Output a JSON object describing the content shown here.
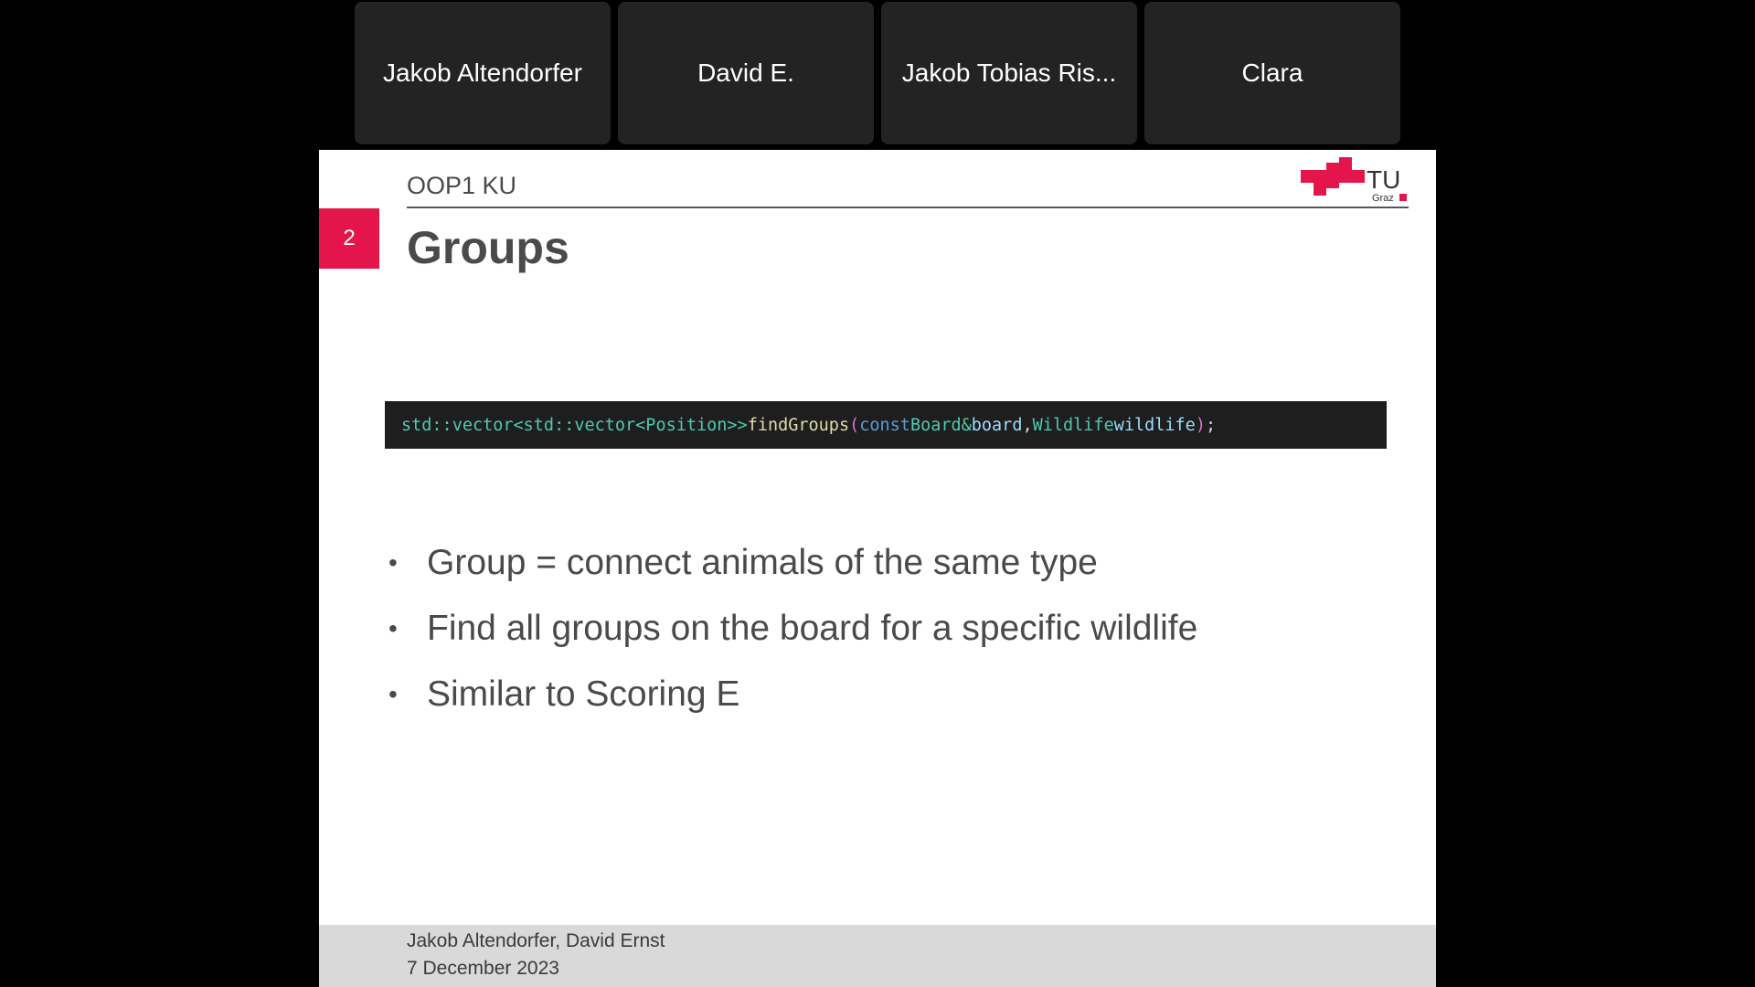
{
  "participants": [
    {
      "name": "Jakob Altendorfer"
    },
    {
      "name": "David E."
    },
    {
      "name": "Jakob Tobias Ris..."
    },
    {
      "name": "Clara"
    }
  ],
  "slide": {
    "course": "OOP1 KU",
    "logo_text": "TU",
    "logo_subtext": "Graz",
    "number": "2",
    "title": "Groups",
    "code": {
      "return_type": "std::vector<std::vector<Position>>",
      "function": "findGroups",
      "open_paren": "(",
      "kw_const": "const",
      "param1_type": "Board&",
      "param1_name": "board",
      "comma": ",",
      "param2_type": "Wildlife",
      "param2_name": "wildlife",
      "close_paren": ")",
      "semicolon": ";"
    },
    "bullets": [
      "Group = connect animals of the same type",
      "Find all groups on the board for a specific wildlife",
      "Similar to Scoring E"
    ],
    "bullet_symbol": "•",
    "footer": {
      "authors": "Jakob Altendorfer, David Ernst",
      "date": "7 December 2023"
    }
  },
  "colors": {
    "accent": "#e4154b",
    "code_bg": "#1e1e1e"
  }
}
